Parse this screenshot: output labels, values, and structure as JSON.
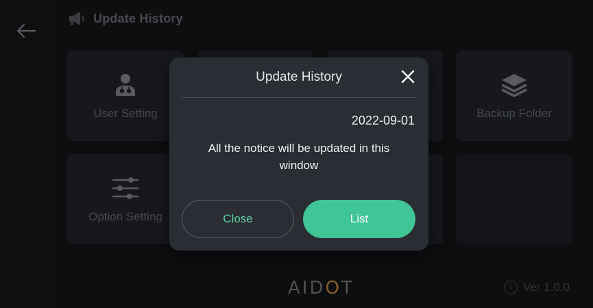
{
  "header": {
    "title": "Update History",
    "icon": "megaphone-icon"
  },
  "tiles": [
    {
      "label": "User Setting",
      "icon": "user-doctor-icon"
    },
    {
      "label": "",
      "icon": ""
    },
    {
      "label": "",
      "icon": ""
    },
    {
      "label": "Backup Folder",
      "icon": "layers-icon"
    },
    {
      "label": "Option Setting",
      "icon": "sliders-icon"
    },
    {
      "label": "",
      "icon": ""
    }
  ],
  "footer": {
    "brand": "AIDOT",
    "version": "Ver 1.0.0"
  },
  "modal": {
    "title": "Update History",
    "date": "2022-09-01",
    "message": "All the notice will be updated in this window",
    "close_label": "Close",
    "list_label": "List"
  },
  "colors": {
    "accent": "#3fc596",
    "brand_dot": "#c8913e",
    "modal_bg": "#2a2d33",
    "tile_bg": "#23262b"
  }
}
